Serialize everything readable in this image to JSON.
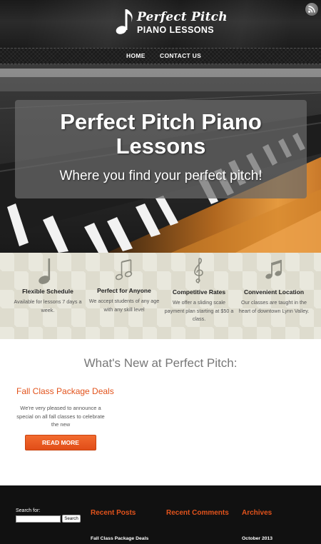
{
  "brand": {
    "name": "Perfect Pitch",
    "subtitle": "PIANO LESSONS"
  },
  "header": {
    "rss_icon": "rss-icon"
  },
  "nav": {
    "items": [
      {
        "label": "HOME"
      },
      {
        "label": "CONTACT US"
      }
    ]
  },
  "hero": {
    "title": "Perfect Pitch Piano Lessons",
    "subtitle": "Where you find your perfect pitch!"
  },
  "features": [
    {
      "icon": "quarter-note-icon",
      "title": "Flexible Schedule",
      "description": "Available for lessons 7 days a week."
    },
    {
      "icon": "eighth-notes-icon",
      "title": "Perfect for Anyone",
      "description": "We accept students of any age with any skill level"
    },
    {
      "icon": "treble-clef-icon",
      "title": "Competitive Rates",
      "description": "We offer a sliding scale payment plan starting at $50 a class."
    },
    {
      "icon": "beamed-notes-icon",
      "title": "Convenient Location",
      "description": "Our classes are taught in the heart of downtown Lynn Valley."
    }
  ],
  "news": {
    "heading": "What's New at Perfect Pitch:",
    "post": {
      "title": "Fall Class Package Deals",
      "excerpt": "We're very pleased to announce a special on all fall classes to celebrate the new",
      "button_label": "READ MORE"
    }
  },
  "footer": {
    "search": {
      "label": "Search for:",
      "value": "",
      "button_label": "Search"
    },
    "recent_posts": {
      "title": "Recent Posts",
      "items": [
        "Fall Class Package Deals"
      ]
    },
    "recent_comments": {
      "title": "Recent Comments",
      "items": []
    },
    "archives": {
      "title": "Archives",
      "items": [
        "October 2013"
      ]
    }
  },
  "colors": {
    "accent": "#e2531c",
    "header_bg": "#1f1f1f",
    "features_bg": "#e9e8dd",
    "footer_bg": "#111111"
  }
}
